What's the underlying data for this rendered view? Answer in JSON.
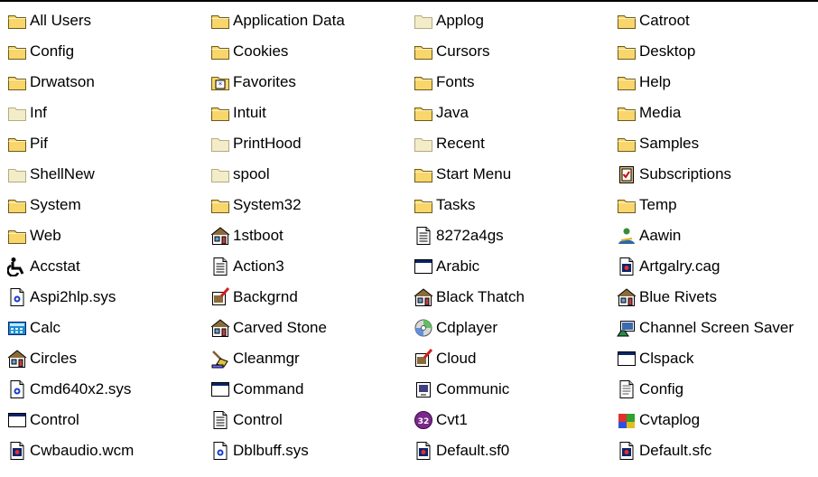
{
  "items": [
    {
      "label": "All Users",
      "icon": "folder-icon"
    },
    {
      "label": "Application Data",
      "icon": "folder-icon"
    },
    {
      "label": "Applog",
      "icon": "folder-hidden-icon"
    },
    {
      "label": "Catroot",
      "icon": "folder-icon"
    },
    {
      "label": "Config",
      "icon": "folder-icon"
    },
    {
      "label": "Cookies",
      "icon": "folder-icon"
    },
    {
      "label": "Cursors",
      "icon": "folder-icon"
    },
    {
      "label": "Desktop",
      "icon": "folder-icon"
    },
    {
      "label": "Drwatson",
      "icon": "folder-icon"
    },
    {
      "label": "Favorites",
      "icon": "favorites-folder-icon"
    },
    {
      "label": "Fonts",
      "icon": "folder-icon"
    },
    {
      "label": "Help",
      "icon": "folder-icon"
    },
    {
      "label": "Inf",
      "icon": "folder-hidden-icon"
    },
    {
      "label": "Intuit",
      "icon": "folder-icon"
    },
    {
      "label": "Java",
      "icon": "folder-icon"
    },
    {
      "label": "Media",
      "icon": "folder-icon"
    },
    {
      "label": "Pif",
      "icon": "folder-icon"
    },
    {
      "label": "PrintHood",
      "icon": "folder-hidden-icon"
    },
    {
      "label": "Recent",
      "icon": "folder-hidden-icon"
    },
    {
      "label": "Samples",
      "icon": "folder-icon"
    },
    {
      "label": "ShellNew",
      "icon": "folder-hidden-icon"
    },
    {
      "label": "spool",
      "icon": "folder-hidden-icon"
    },
    {
      "label": "Start Menu",
      "icon": "folder-icon"
    },
    {
      "label": "Subscriptions",
      "icon": "subscriptions-icon"
    },
    {
      "label": "System",
      "icon": "folder-icon"
    },
    {
      "label": "System32",
      "icon": "folder-icon"
    },
    {
      "label": "Tasks",
      "icon": "folder-icon"
    },
    {
      "label": "Temp",
      "icon": "folder-icon"
    },
    {
      "label": "Web",
      "icon": "folder-icon"
    },
    {
      "label": "1stboot",
      "icon": "theme-icon"
    },
    {
      "label": "8272a4gs",
      "icon": "text-document-icon"
    },
    {
      "label": "Aawin",
      "icon": "aawin-icon"
    },
    {
      "label": "Accstat",
      "icon": "accessibility-icon"
    },
    {
      "label": "Action3",
      "icon": "text-document-icon"
    },
    {
      "label": "Arabic",
      "icon": "application-window-icon"
    },
    {
      "label": "Artgalry.cag",
      "icon": "media-file-icon"
    },
    {
      "label": "Aspi2hlp.sys",
      "icon": "system-file-icon"
    },
    {
      "label": "Backgrnd",
      "icon": "paint-icon"
    },
    {
      "label": "Black Thatch",
      "icon": "theme-icon"
    },
    {
      "label": "Blue Rivets",
      "icon": "theme-icon"
    },
    {
      "label": "Calc",
      "icon": "calculator-icon"
    },
    {
      "label": "Carved Stone",
      "icon": "theme-icon"
    },
    {
      "label": "Cdplayer",
      "icon": "cd-player-icon"
    },
    {
      "label": "Channel Screen Saver",
      "icon": "screensaver-icon"
    },
    {
      "label": "Circles",
      "icon": "theme-icon"
    },
    {
      "label": "Cleanmgr",
      "icon": "cleanup-icon"
    },
    {
      "label": "Cloud",
      "icon": "paint-icon"
    },
    {
      "label": "Clspack",
      "icon": "application-window-icon"
    },
    {
      "label": "Cmd640x2.sys",
      "icon": "system-file-icon"
    },
    {
      "label": "Command",
      "icon": "application-window-icon"
    },
    {
      "label": "Communic",
      "icon": "communications-icon"
    },
    {
      "label": "Config",
      "icon": "notepad-document-icon"
    },
    {
      "label": "Control",
      "icon": "application-window-icon"
    },
    {
      "label": "Control",
      "icon": "text-document-icon"
    },
    {
      "label": "Cvt1",
      "icon": "cvt-icon"
    },
    {
      "label": "Cvtaplog",
      "icon": "cvtaplog-icon"
    },
    {
      "label": "Cwbaudio.wcm",
      "icon": "media-file-icon"
    },
    {
      "label": "Dblbuff.sys",
      "icon": "system-file-icon"
    },
    {
      "label": "Default.sf0",
      "icon": "media-file-icon"
    },
    {
      "label": "Default.sfc",
      "icon": "media-file-icon"
    }
  ]
}
